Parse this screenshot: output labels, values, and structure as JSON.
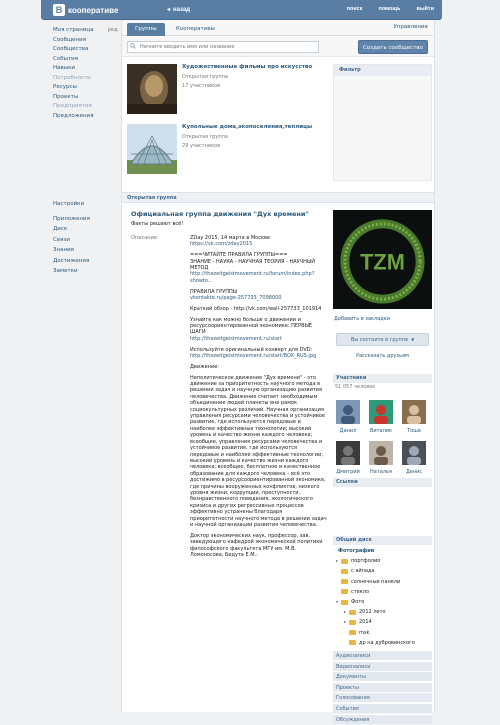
{
  "header": {
    "logo_letter": "В",
    "logo_text": "кооперативе",
    "back_label": "назад",
    "nav": [
      "поиск",
      "помощь",
      "выйти"
    ]
  },
  "left_menu": [
    {
      "label": "Моя страница",
      "extra": "ред."
    },
    {
      "label": "Сообщения"
    },
    {
      "label": "Сообщества"
    },
    {
      "label": "События"
    },
    {
      "label": "Навыки"
    },
    {
      "label": "Потребности"
    },
    {
      "label": "Ресурсы"
    },
    {
      "label": "Проекты"
    },
    {
      "label": "Предприятия"
    },
    {
      "label": "Предложения"
    }
  ],
  "left_menu_bottom": [
    "Настройки",
    "Приложения",
    "Диск",
    "Связи",
    "Знания",
    "Достижения",
    "Заметки"
  ],
  "tabs": {
    "groups": "Группы",
    "coops": "Кооперативы",
    "manage": "Управление"
  },
  "search": {
    "placeholder": "Начните вводить имя или название",
    "create_label": "Создать сообщество"
  },
  "groups": [
    {
      "title": "Художественные фильмы про искусство",
      "type": "Открытая группа",
      "count": "17 участников"
    },
    {
      "title": "Купольные дома,экопоселения,теплицы",
      "type": "Открытая группа",
      "count": "29 участников"
    }
  ],
  "filter_label": "Фильтр",
  "open_group_label": "Открытая группа",
  "page": {
    "title": "Официальная группа движения \"Дух времени\"",
    "status": "Факты решают всё!",
    "desc_label": "Описание:",
    "description": [
      [
        "ZDay 2015, 14 марта в Москве",
        "https://vk.com/zday2015"
      ],
      [
        "===ЧИТАЙТЕ ПРАВИЛА ГРУППЫ===",
        "ЗНАНИЕ - НАУКА - НАУЧНАЯ ТЕОРИЯ - НАУЧНЫЙ МЕТОД",
        "http://thezeitgeistmovement.ru/forum/index.php?showto..."
      ],
      [
        "ПРАВИЛА ГРУППЫ",
        "vkontakte.ru/page-257733_7098000"
      ],
      [
        "Краткий обзор - http://vk.com/wall-257733_101914"
      ],
      [
        "Узнайте как можно больше о движении и ресурсоориентированной экономике: ПЕРВЫЕ ШАГИ",
        "http://thezeitgeistmovement.ru/start"
      ],
      [
        "Используйте оригинальный конверт для DVD:",
        "http://thezeitgeistmovement.ru/start/BOX_RUS.jpg"
      ],
      [
        "Движение:"
      ],
      [
        "Неполитическое движение \"Дух времени\" - это движение за приоритетность научного метода в решении задач и научную организацию развития человечества. Движение считает необходимым объединение людей планеты вне рамок социокультурных различий. Научная организация управления ресурсами человечества и устойчивое развитие, где используются передовые и наиболее эффективные технологии; высокий уровень и качество жизни каждого человека; всеобщее, управления ресурсами человечества и устойчивое развитие, где используются передовые и наиболее эффективные технологии; высокий уровень и качество жизни каждого человека; всеобщее, бесплатное и качественное образование для каждого человека – всё это достижимо в ресурсоориентированной экономике, где причины вооруженных конфликтов, низкого уровня жизни, коррупции, преступности, безнравственного поведения, экологического кризиса и других регрессивных процессов эффективно устранены благодаря приоритетности научного метода в решении задач и научной организации развития человечества."
      ],
      [
        "Доктор экономических наук, профессор, зав. заведующего кафедрой экономической политики философского факультета МГУ им. М.В. Ломоносова, Бедута Е.М.:"
      ]
    ]
  },
  "right": {
    "avatar_text": "TZM",
    "add_bookmark": "Добавить в закладки",
    "join_label": "Вы состоите в группе",
    "tell_friends": "Рассказать друзьям",
    "members_label": "Участники",
    "members_count": "51 057 человек",
    "members": [
      "Данил",
      "Виталик",
      "Тоша",
      "Дмитрий",
      "Наталья",
      "Денис"
    ],
    "links_label": "Ссылки",
    "docs_label": "Общий диск",
    "tree": [
      {
        "label": "Фотографии",
        "level": 0,
        "tri": "",
        "header": true
      },
      {
        "label": "портфолио",
        "level": 0,
        "tri": "▸"
      },
      {
        "label": "с айпада",
        "level": 0,
        "tri": ""
      },
      {
        "label": "солнечные панели",
        "level": 0,
        "tri": ""
      },
      {
        "label": "стекло",
        "level": 0,
        "tri": ""
      },
      {
        "label": "Фото",
        "level": 0,
        "tri": "▾"
      },
      {
        "label": "2012 лето",
        "level": 1,
        "tri": "▸"
      },
      {
        "label": "2014",
        "level": 1,
        "tri": "▸"
      },
      {
        "label": "msk",
        "level": 1,
        "tri": ""
      },
      {
        "label": "др на дубровинского",
        "level": 1,
        "tri": ""
      }
    ],
    "sections": [
      "Аудиозаписи",
      "Видеозаписи",
      "Документы",
      "Проекты",
      "Голосования",
      "События",
      "Обсуждения"
    ]
  },
  "colors": {
    "header": "#597da3",
    "link": "#2b587a",
    "folder": "#e9b545"
  }
}
